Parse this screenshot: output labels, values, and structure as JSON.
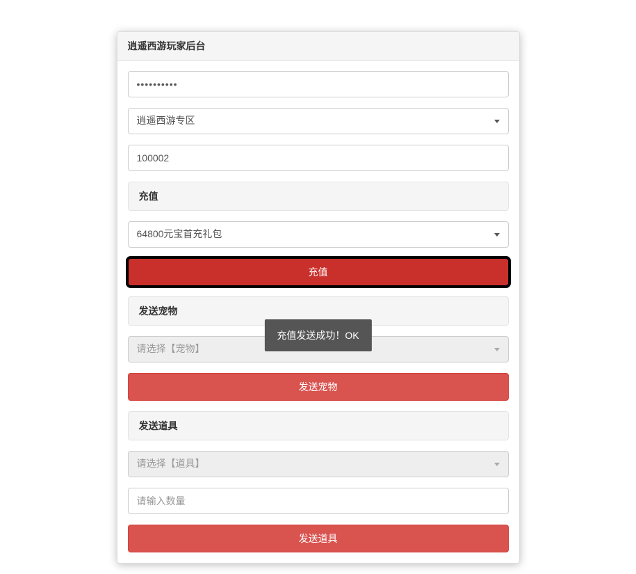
{
  "panel": {
    "title": "逍遥西游玩家后台"
  },
  "password": {
    "value": "••••••••••"
  },
  "server_select": {
    "selected": "逍遥西游专区"
  },
  "id_input": {
    "value": "100002"
  },
  "recharge": {
    "section_title": "充值",
    "package_selected": "64800元宝首充礼包",
    "button_label": "充值"
  },
  "pet": {
    "section_title": "发送宠物",
    "placeholder": "请选择【宠物】",
    "button_label": "发送宠物"
  },
  "item": {
    "section_title": "发送道具",
    "select_placeholder": "请选择【道具】",
    "quantity_placeholder": "请输入数量",
    "button_label": "发送道具"
  },
  "toast": {
    "message": "充值发送成功！OK"
  }
}
